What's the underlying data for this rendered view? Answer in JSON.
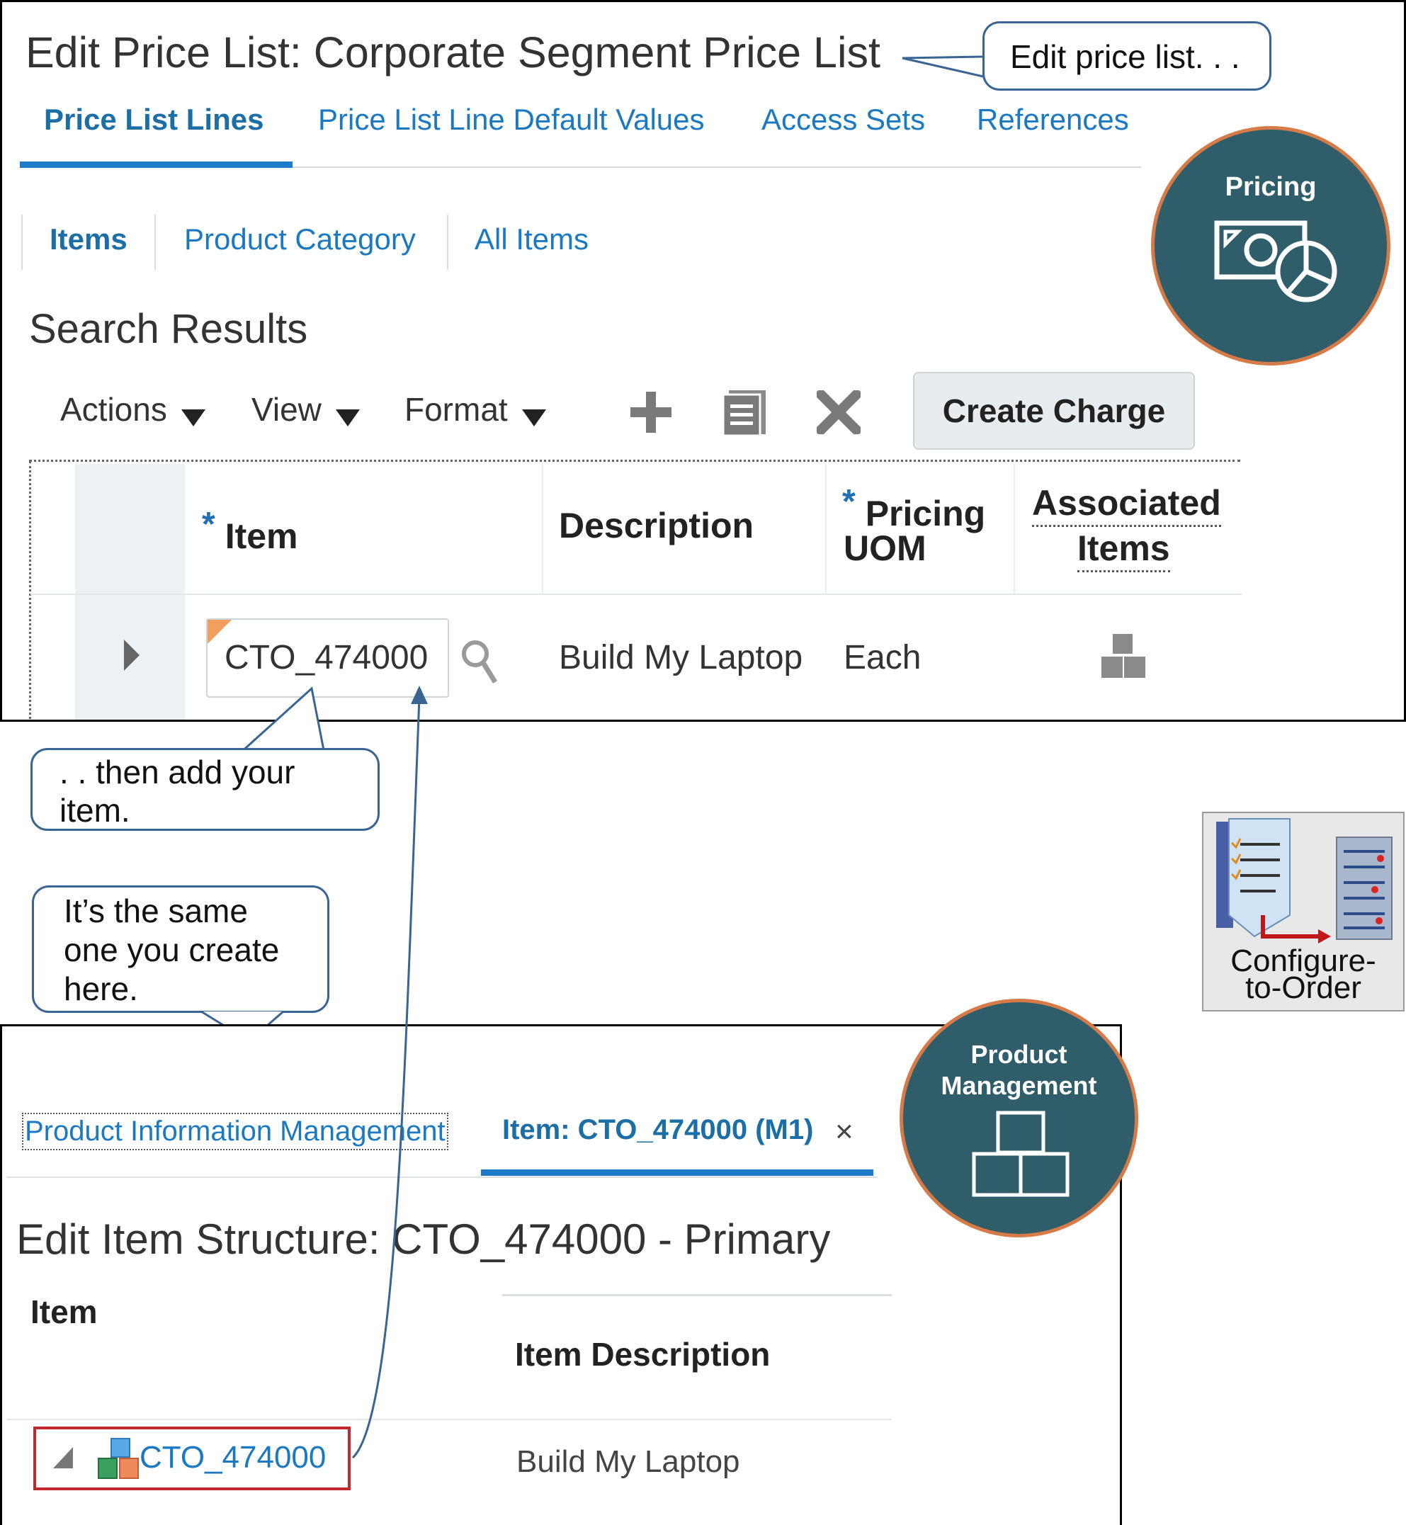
{
  "price_list": {
    "title": "Edit Price List: Corporate Segment Price List",
    "tabs": [
      "Price List Lines",
      "Price List Line Default Values",
      "Access Sets",
      "References"
    ],
    "subtabs": [
      "Items",
      "Product Category",
      "All Items"
    ],
    "section_title": "Search Results",
    "toolbar": {
      "actions": "Actions",
      "view": "View",
      "format": "Format",
      "create_charge": "Create Charge"
    },
    "columns": {
      "item": "Item",
      "description": "Description",
      "pricing_uom_1": "Pricing",
      "pricing_uom_2": "UOM",
      "associated_1": "Associated",
      "associated_2": "Items",
      "required_mark": "*"
    },
    "row": {
      "item": "CTO_474000",
      "description": "Build My Laptop",
      "uom": "Each"
    }
  },
  "callouts": {
    "edit_price_list": "Edit price list. . .",
    "add_item_1": ". . then add your",
    "add_item_2": "item.",
    "same_one_1": "It’s the same",
    "same_one_2": "one you create",
    "same_one_3": "here."
  },
  "badges": {
    "pricing": "Pricing",
    "product_management_1": "Product",
    "product_management_2": "Management"
  },
  "cto_icon": {
    "line1": "Configure-",
    "line2": "to-Order"
  },
  "product_mgmt": {
    "tab_pim": "Product Information Management",
    "tab_item": "Item: CTO_474000 (M1)",
    "close_glyph": "×",
    "title": "Edit Item Structure: CTO_474000 - Primary",
    "col_item": "Item",
    "col_desc": "Item Description",
    "row_item": "CTO_474000",
    "row_desc": "Build My Laptop"
  },
  "colors": {
    "link": "#1a79c2",
    "badge_fill": "#2f5e6a",
    "badge_ring": "#d67a48",
    "callout_border": "#3a6592",
    "highlight_box": "#c0282d"
  }
}
